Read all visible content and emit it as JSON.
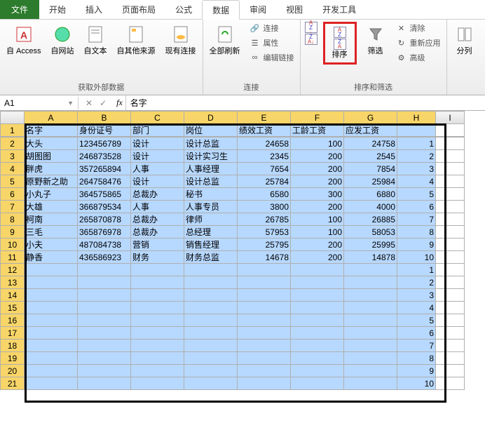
{
  "tabs": {
    "file": "文件",
    "home": "开始",
    "insert": "插入",
    "layout": "页面布局",
    "formula": "公式",
    "data": "数据",
    "review": "审阅",
    "view": "视图",
    "dev": "开发工具"
  },
  "ribbon": {
    "group1": {
      "access": "自 Access",
      "web": "自网站",
      "text": "自文本",
      "other": "自其他来源",
      "existing": "现有连接",
      "label": "获取外部数据"
    },
    "group2": {
      "refresh": "全部刷新",
      "connect": "连接",
      "props": "属性",
      "editlinks": "编辑链接",
      "label": "连接"
    },
    "group3": {
      "sort": "排序",
      "filter": "筛选",
      "clear": "清除",
      "reapply": "重新应用",
      "advanced": "高级",
      "label": "排序和筛选"
    },
    "group4": {
      "split": "分列"
    }
  },
  "namebox": "A1",
  "formula": "名字",
  "cols": [
    "A",
    "B",
    "C",
    "D",
    "E",
    "F",
    "G",
    "H",
    "I"
  ],
  "headers": [
    "名字",
    "身份证号",
    "部门",
    "岗位",
    "绩效工资",
    "工龄工资",
    "应发工资"
  ],
  "rows": [
    {
      "a": "大头",
      "b": "123456789",
      "c": "设计",
      "d": "设计总监",
      "e": "24658",
      "f": "100",
      "g": "24758",
      "h": "1"
    },
    {
      "a": "胡图图",
      "b": "246873528",
      "c": "设计",
      "d": "设计实习生",
      "e": "2345",
      "f": "200",
      "g": "2545",
      "h": "2"
    },
    {
      "a": "胖虎",
      "b": "357265894",
      "c": "人事",
      "d": "人事经理",
      "e": "7654",
      "f": "200",
      "g": "7854",
      "h": "3"
    },
    {
      "a": "原野新之助",
      "b": "264758476",
      "c": "设计",
      "d": "设计总监",
      "e": "25784",
      "f": "200",
      "g": "25984",
      "h": "4"
    },
    {
      "a": "小丸子",
      "b": "364575865",
      "c": "总裁办",
      "d": "秘书",
      "e": "6580",
      "f": "300",
      "g": "6880",
      "h": "5"
    },
    {
      "a": "大雄",
      "b": "366879534",
      "c": "人事",
      "d": "人事专员",
      "e": "3800",
      "f": "200",
      "g": "4000",
      "h": "6"
    },
    {
      "a": "柯南",
      "b": "265870878",
      "c": "总裁办",
      "d": "律师",
      "e": "26785",
      "f": "100",
      "g": "26885",
      "h": "7"
    },
    {
      "a": "三毛",
      "b": "365876978",
      "c": "总裁办",
      "d": "总经理",
      "e": "57953",
      "f": "100",
      "g": "58053",
      "h": "8"
    },
    {
      "a": "小夫",
      "b": "487084738",
      "c": "营销",
      "d": "销售经理",
      "e": "25795",
      "f": "200",
      "g": "25995",
      "h": "9"
    },
    {
      "a": "静香",
      "b": "436586923",
      "c": "财务",
      "d": "财务总监",
      "e": "14678",
      "f": "200",
      "g": "14878",
      "h": "10"
    }
  ],
  "empty_h": [
    "1",
    "2",
    "3",
    "4",
    "5",
    "6",
    "7",
    "8",
    "9",
    "10"
  ]
}
